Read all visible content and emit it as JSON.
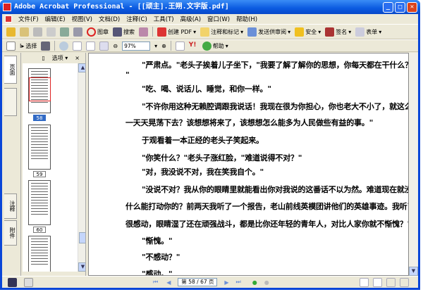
{
  "window": {
    "title": "Adobe Acrobat Professional - [[顽主].王朔.文字版.pdf]",
    "minimize": "_",
    "maximize": "□",
    "close": "✕"
  },
  "menu": [
    "文件(F)",
    "编辑(E)",
    "视图(V)",
    "文档(D)",
    "注释(C)",
    "工具(T)",
    "高级(A)",
    "窗口(W)",
    "帮助(H)"
  ],
  "toolbar1": {
    "stamp": "图章",
    "search": "搜索",
    "create_pdf": "创建 PDF",
    "comment_markup": "注释和标记",
    "send_review": "发送供审阅",
    "security": "安全",
    "sign": "签名",
    "forms": "表单"
  },
  "toolbar2": {
    "select": "选择",
    "zoom_value": "97%",
    "help": "帮助"
  },
  "side_tabs": [
    "页面",
    "书签",
    "注释",
    "附件"
  ],
  "panel": {
    "options": "选项",
    "close": "×",
    "pages": [
      "58",
      "59",
      "60"
    ],
    "selected_page": "58"
  },
  "document": {
    "lines": [
      "\"严肃点。\"老头子挨着儿子坐下，\"我要了解了解你的思想，你每天都在干什么？",
      "\"",
      "\"吃、喝、说话儿、睡觉，和你一样。\"",
      "\"不许你用这种无赖腔调跟我说话！我现在很为你担心，你也老大不小了，就这么",
      "一天天晃荡下去？该想想将来了，该想想怎么能多为人民做些有益的事。\"",
      "于观看着一本正经的老头子笑起来。",
      "\"你笑什么？\"老头子涨红脸，\"难道说得不对？\"",
      "\"对，我没说不对，我在笑我自个。\"",
      "\"没说不对？我从你的眼睛里就能看出你对我说的这番话不以为然。难道现在就没",
      "什么能打动你的？前两天我听了一个报告，老山前线英模团讲他们的英雄事迹。我听了",
      "很感动，眼睛湿了还在顽强战斗，都是比你还年轻的青年人，对比人家你就不惭愧？\"",
      "\"惭愧。\"",
      "\"不感动？\"",
      "\"感动。\""
    ],
    "indent": [
      true,
      false,
      true,
      true,
      false,
      true,
      true,
      true,
      true,
      false,
      false,
      true,
      true,
      true
    ]
  },
  "status": {
    "page_display": "第 58 / 67 页",
    "current_page": 58,
    "total_pages": 67
  }
}
